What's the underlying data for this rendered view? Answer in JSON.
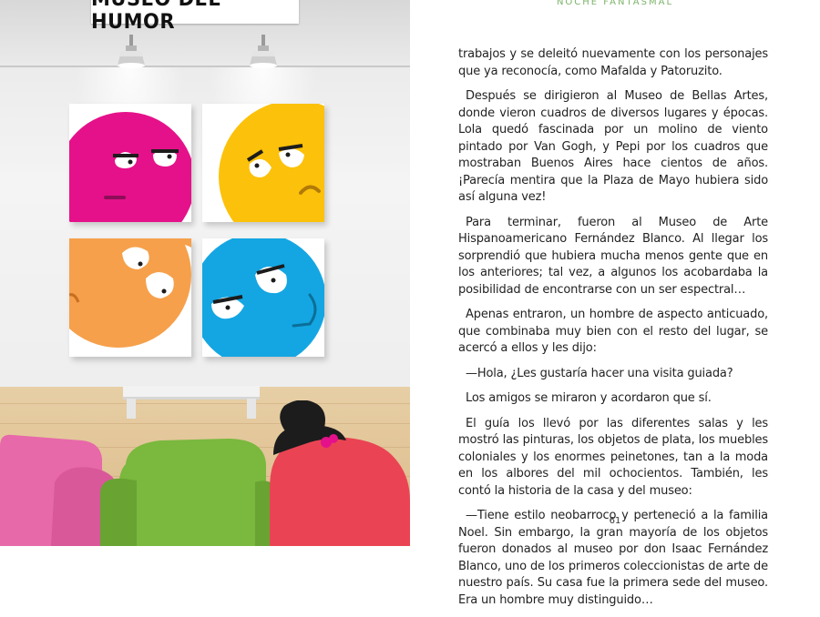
{
  "illustration": {
    "sign_text": "MUSEO DEL HUMOR",
    "colors": {
      "magenta": "#e5118a",
      "yellow": "#fcc10a",
      "orange": "#f6a04b",
      "cyan": "#14a6e2",
      "couch_pink": "#e769a9",
      "chair_green": "#7ab83e",
      "figure_red": "#ea4454",
      "hair_black": "#1c1c1c"
    },
    "paintings": [
      {
        "name": "magenta-face-painting",
        "icon": "magenta-face"
      },
      {
        "name": "yellow-face-painting",
        "icon": "yellow-face"
      },
      {
        "name": "orange-face-painting",
        "icon": "orange-face"
      },
      {
        "name": "blue-face-painting",
        "icon": "blue-face"
      }
    ]
  },
  "page": {
    "running_head": "NOCHE FANTASMAL",
    "page_number": "61",
    "paragraphs": [
      "trabajos y se deleitó nuevamente con los personajes que ya reconocía, como Mafalda y Patoruzito.",
      "Después se dirigieron al Museo de Bellas Artes, donde vieron cuadros de diversos lugares y épocas. Lola quedó fascinada por un molino de viento pintado por Van Gogh, y Pepi por los cuadros que mostraban Buenos Aires hace cientos de años. ¡Parecía mentira que la Plaza de Mayo hubiera sido así alguna vez!",
      "Para terminar, fueron al Museo de Arte Hispanoamericano Fernández Blanco. Al llegar los sorprendió que hubiera mucha menos gente que en los anteriores; tal vez, a algunos los acobardaba la posibilidad de encontrarse con un ser espectral…",
      "Apenas entraron, un hombre de aspecto anticuado, que combinaba muy bien con el resto del lugar, se acercó a ellos y les dijo:",
      "—Hola, ¿Les gustaría hacer una visita guiada?",
      "Los amigos se miraron y acordaron que sí.",
      "El guía los llevó por las diferentes salas y les mostró las pinturas, los objetos de plata, los muebles coloniales y los enormes peinetones, tan a la moda en los albores del mil ochocientos. También, les contó la historia de la casa y del museo:",
      "—Tiene estilo neobarroco y perteneció a la familia Noel. Sin embargo, la gran mayoría de los objetos fueron donados al museo por don Isaac Fernández Blanco, uno de los primeros coleccionistas de arte de nuestro país. Su casa fue la primera sede del museo. Era un hombre muy distinguido…"
    ]
  }
}
